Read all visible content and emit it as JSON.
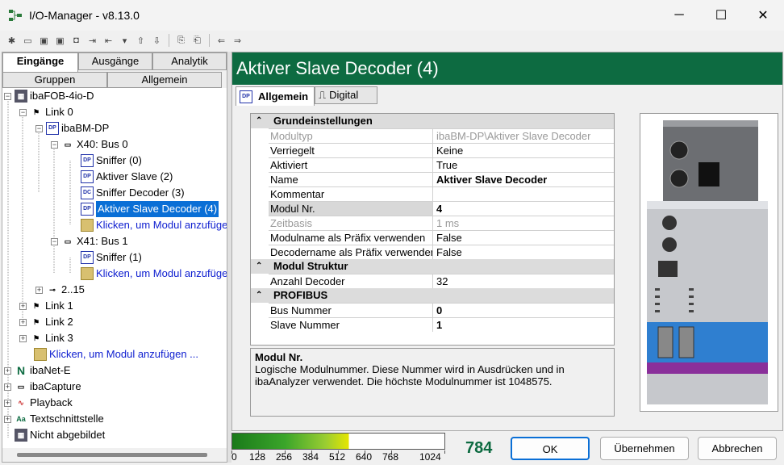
{
  "window": {
    "title": "I/O-Manager - v8.13.0"
  },
  "left_tabs": {
    "top": [
      "Eingänge",
      "Ausgänge",
      "Analytik"
    ],
    "bottom": [
      "Gruppen",
      "Allgemein"
    ]
  },
  "tree": [
    {
      "label": "ibaFOB-4io-D"
    },
    {
      "label": "Link 0"
    },
    {
      "label": "ibaBM-DP"
    },
    {
      "label": "X40: Bus 0"
    },
    {
      "label": "Sniffer (0)"
    },
    {
      "label": "Aktiver Slave (2)"
    },
    {
      "label": "Sniffer Decoder (3)"
    },
    {
      "label": "Aktiver Slave Decoder (4)"
    },
    {
      "label": "Klicken, um Modul anzufügen ..."
    },
    {
      "label": "X41: Bus 1"
    },
    {
      "label": "Sniffer (1)"
    },
    {
      "label": "Klicken, um Modul anzufügen ..."
    },
    {
      "label": "2..15"
    },
    {
      "label": "Link 1"
    },
    {
      "label": "Link 2"
    },
    {
      "label": "Link 3"
    },
    {
      "label": "Klicken, um Modul anzufügen ..."
    },
    {
      "label": "ibaNet-E"
    },
    {
      "label": "ibaCapture"
    },
    {
      "label": "Playback"
    },
    {
      "label": "Textschnittstelle"
    },
    {
      "label": "Nicht abgebildet"
    }
  ],
  "header": {
    "title": "Aktiver Slave Decoder (4)"
  },
  "right_tabs": [
    "Allgemein",
    "Digital"
  ],
  "props": {
    "cat1": "Grundeinstellungen",
    "cat2": "Modul Struktur",
    "cat3": "PROFIBUS",
    "rows": [
      {
        "name": "Modultyp",
        "value": "ibaBM-DP\\Aktiver Slave Decoder"
      },
      {
        "name": "Verriegelt",
        "value": "Keine"
      },
      {
        "name": "Aktiviert",
        "value": "True"
      },
      {
        "name": "Name",
        "value": "Aktiver Slave Decoder"
      },
      {
        "name": "Kommentar",
        "value": ""
      },
      {
        "name": "Modul Nr.",
        "value": "4"
      },
      {
        "name": "Zeitbasis",
        "value": "1 ms"
      },
      {
        "name": "Modulname als Präfix verwenden",
        "value": "False"
      },
      {
        "name": "Decodername als Präfix verwenden",
        "value": "False"
      },
      {
        "name": "Anzahl Decoder",
        "value": "32"
      },
      {
        "name": "Bus Nummer",
        "value": "0"
      },
      {
        "name": "Slave Nummer",
        "value": "1"
      }
    ]
  },
  "description": {
    "title": "Modul Nr.",
    "text": "Logische Modulnummer. Diese Nummer wird in Ausdrücken und in ibaAnalyzer verwendet. Die höchste Modulnummer ist 1048575."
  },
  "gauge": {
    "ticks": [
      "0",
      "128",
      "256",
      "384",
      "512",
      "640",
      "768",
      "1024"
    ],
    "value": "784",
    "fill_fraction": 0.55
  },
  "buttons": {
    "ok": "OK",
    "apply": "Übernehmen",
    "cancel": "Abbrechen"
  }
}
